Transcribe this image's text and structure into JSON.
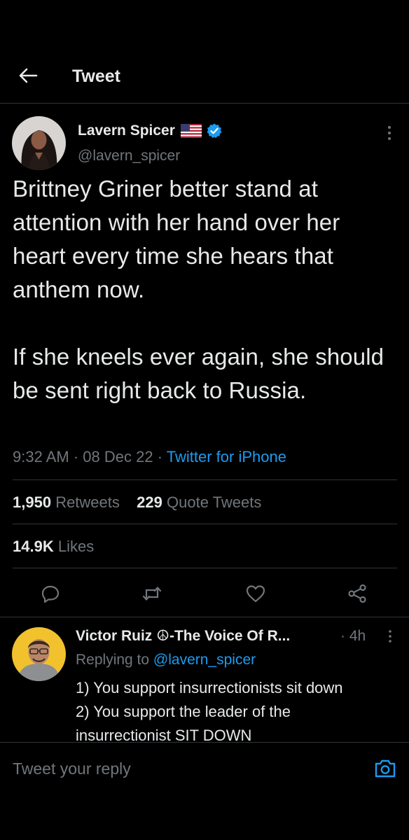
{
  "header": {
    "back_icon": "arrow-left-icon",
    "title": "Tweet"
  },
  "tweet": {
    "author_name": "Lavern Spicer",
    "badges": [
      "us-flag-icon",
      "verified-icon"
    ],
    "handle": "@lavern_spicer",
    "text": "Brittney Griner better stand at attention with her hand over her heart every time she hears that anthem now.\n\nIf she kneels ever again, she should be sent right back to Russia.",
    "time": "9:32 AM",
    "date": "08 Dec 22",
    "source": "Twitter for iPhone",
    "stats": {
      "retweets_count": "1,950",
      "retweets_label": "Retweets",
      "quotes_count": "229",
      "quotes_label": "Quote Tweets",
      "likes_count": "14.9K",
      "likes_label": "Likes"
    },
    "actions": [
      "reply-icon",
      "retweet-icon",
      "like-icon",
      "share-icon"
    ]
  },
  "reply": {
    "author_name": "Victor Ruiz ☮-The Voice Of R...",
    "time": "4h",
    "replying_prefix": "Replying to",
    "replying_handle": "@lavern_spicer",
    "lines": [
      "1) You support insurrectionists sit down",
      "2) You support the leader of the",
      "insurrectionist SIT DOWN"
    ]
  },
  "composer": {
    "placeholder": "Tweet your reply",
    "camera_icon": "camera-icon"
  },
  "colors": {
    "background": "#000000",
    "text": "#e7e9ea",
    "secondary": "#71767b",
    "accent": "#1d9bf0",
    "divider": "#2f3336"
  }
}
